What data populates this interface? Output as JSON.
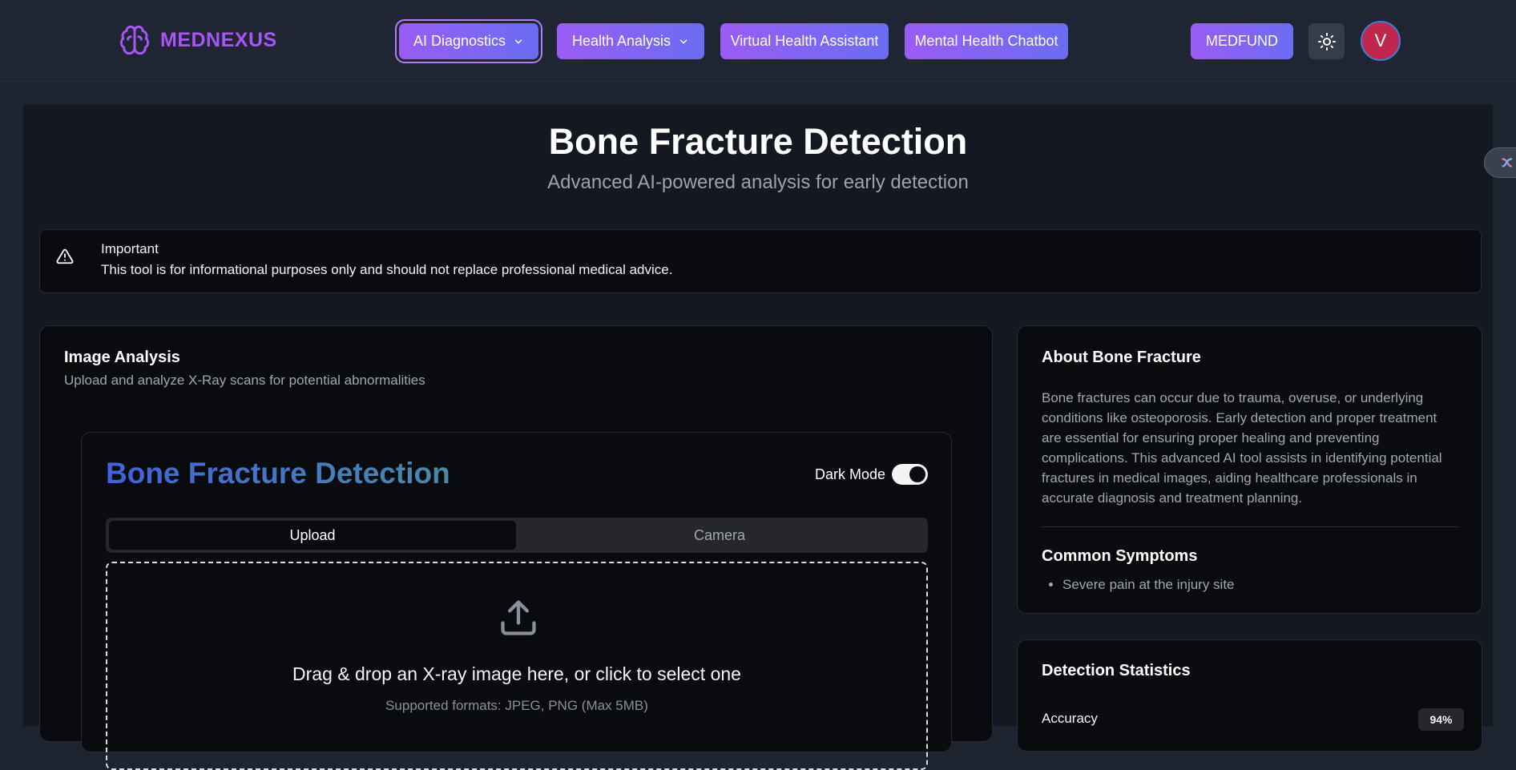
{
  "brand": {
    "name": "MEDNEXUS",
    "icon": "brain-icon"
  },
  "nav": {
    "items": [
      {
        "label": "AI Diagnostics",
        "has_dropdown": true,
        "active": true
      },
      {
        "label": "Health Analysis",
        "has_dropdown": true
      },
      {
        "label": "Virtual Health Assistant"
      },
      {
        "label": "Mental Health Chatbot"
      }
    ],
    "medfund_label": "MEDFUND",
    "theme_icon": "sun-icon",
    "avatar_initial": "V"
  },
  "header": {
    "title": "Bone Fracture Detection",
    "subtitle": "Advanced AI-powered analysis for early detection"
  },
  "alert": {
    "icon": "warning-icon",
    "title": "Important",
    "text": "This tool is for informational purposes only and should not replace professional medical advice."
  },
  "analysis": {
    "title": "Image Analysis",
    "description": "Upload and analyze X-Ray scans for potential abnormalities",
    "tool_title": "Bone Fracture Detection",
    "dark_mode_label": "Dark Mode",
    "dark_mode_on": true,
    "tabs": [
      "Upload",
      "Camera"
    ],
    "active_tab": "Upload",
    "dropzone": {
      "icon": "upload-icon",
      "text": "Drag & drop an X-ray image here, or click to select one",
      "subtext": "Supported formats: JPEG, PNG (Max 5MB)"
    }
  },
  "about": {
    "title": "About Bone Fracture",
    "lines": [
      "Bone fractures can occur due to trauma, overuse, or underlying",
      "conditions like osteoporosis. Early detection and proper treatment",
      "are essential for ensuring proper healing and preventing",
      "complications. This advanced AI tool assists in identifying potential",
      "fractures in medical images, aiding healthcare professionals in",
      "accurate diagnosis and treatment planning."
    ],
    "symptoms_title": "Common Symptoms",
    "symptoms": [
      "Severe pain at the injury site"
    ]
  },
  "stats": {
    "title": "Detection Statistics",
    "accuracy_label": "Accuracy",
    "accuracy_value": "94%"
  },
  "colors": {
    "accent_purple": "#a855f7",
    "button_gradient_start": "#9a5cf5",
    "button_gradient_end": "#6a6df2",
    "avatar_bg": "#c0274c"
  }
}
